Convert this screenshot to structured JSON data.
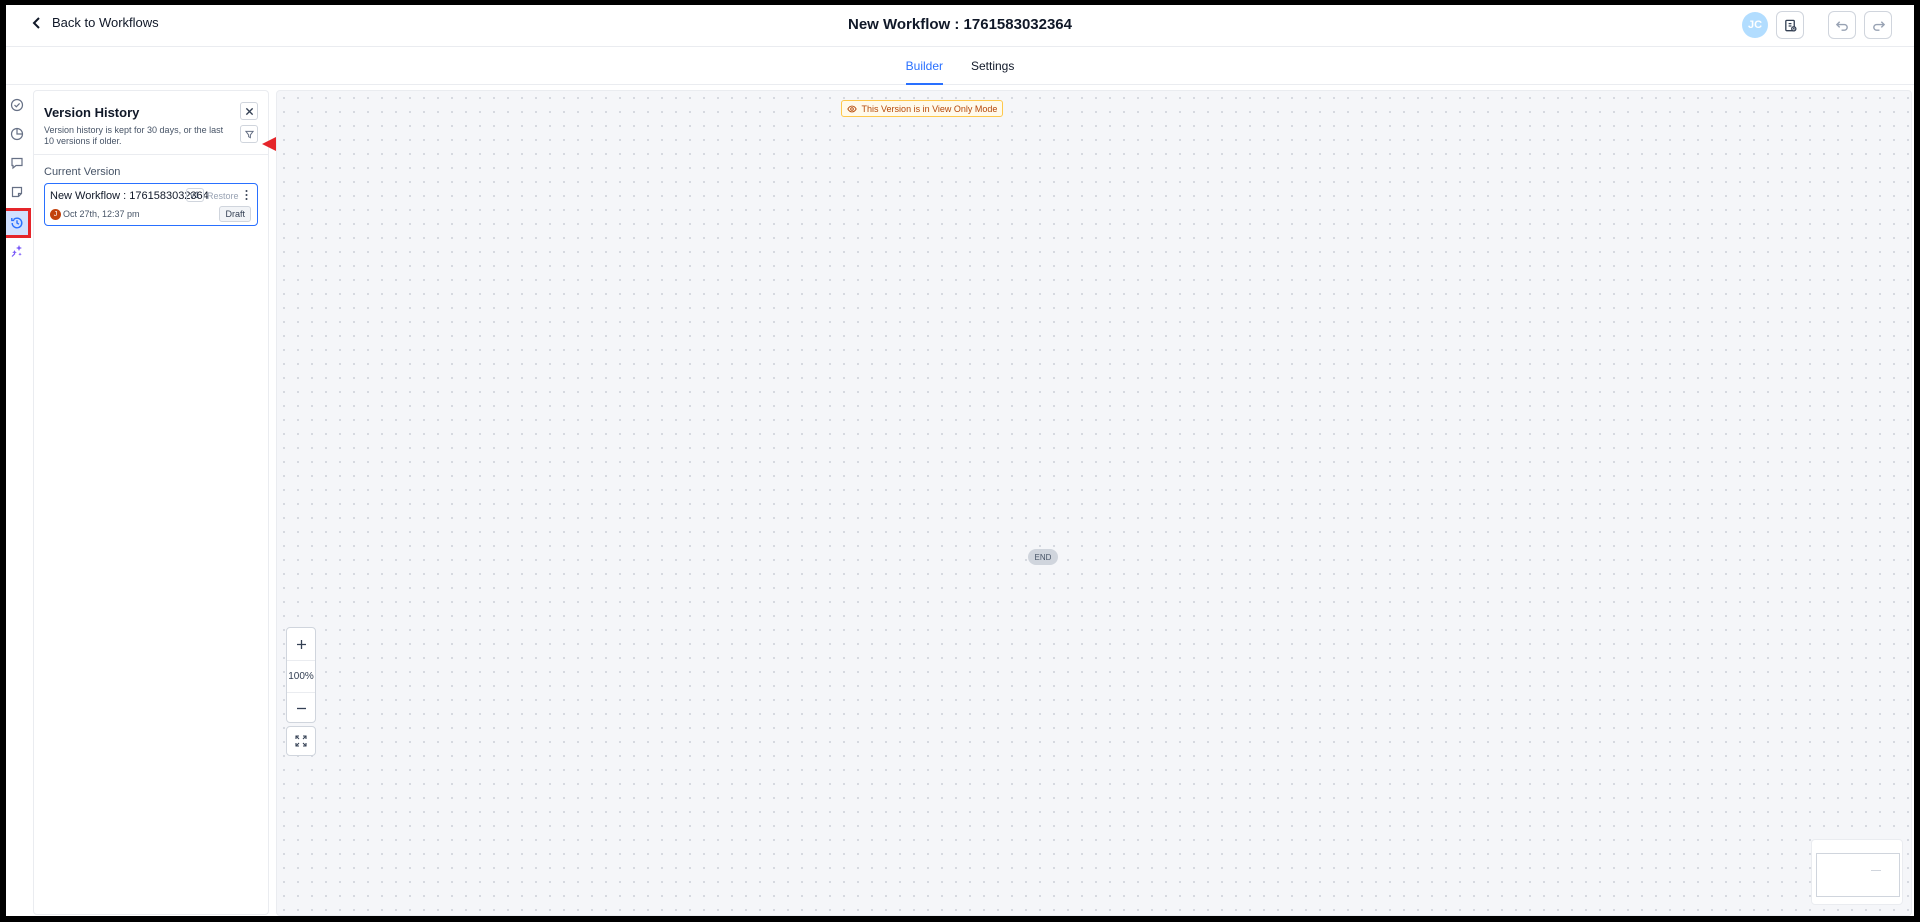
{
  "header": {
    "back_label": "Back to Workflows",
    "title": "New Workflow : 1761583032364",
    "avatar_initials": "JC"
  },
  "tabs": [
    {
      "label": "Builder",
      "active": true
    },
    {
      "label": "Settings",
      "active": false
    }
  ],
  "rail": {
    "items": [
      "check-circle-icon",
      "pie-chart-icon",
      "comment-icon",
      "note-icon",
      "history-icon",
      "sparkles-icon"
    ],
    "active": "history-icon"
  },
  "version_panel": {
    "title": "Version History",
    "description": "Version history is kept for 30 days, or the last 10 versions if older.",
    "section_label": "Current Version",
    "card": {
      "name": "New Workflow : 1761583032364",
      "version": "v1",
      "restore_label": "Restore",
      "author_initial": "J",
      "date": "Oct 27th, 12:37 pm",
      "status": "Draft"
    }
  },
  "canvas": {
    "banner": "This Version is in View Only Mode",
    "end_node": "END",
    "zoom_level": "100%"
  },
  "colors": {
    "accent": "#2970ff",
    "annotation_red": "#e5252a",
    "banner_bg": "#fffaeb",
    "banner_text": "#b54708"
  }
}
